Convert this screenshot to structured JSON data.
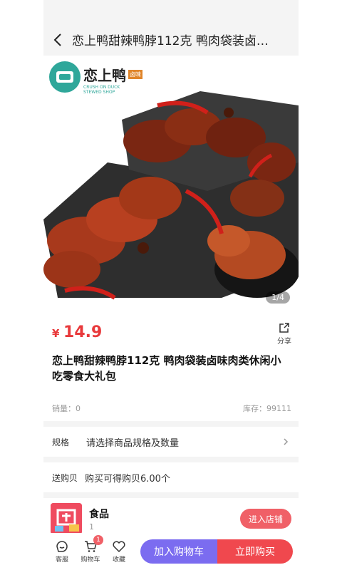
{
  "header": {
    "title": "恋上鸭甜辣鸭脖112克 鸭肉袋装卤…"
  },
  "gallery": {
    "brand_name": "恋上鸭",
    "brand_tag": "卤味",
    "brand_sub1": "CRUSH ON DUCK",
    "brand_sub2": "STEWED SHOP",
    "counter": "1/4"
  },
  "product": {
    "currency": "¥",
    "price": "14.9",
    "share_label": "分享",
    "title": "恋上鸭甜辣鸭脖112克 鸭肉袋装卤味肉类休闲小吃零食大礼包",
    "sales": "销量：0",
    "stock": "库存：99111"
  },
  "spec": {
    "label": "规格",
    "value": "请选择商品规格及数量"
  },
  "points": {
    "label": "送购贝",
    "value": "购买可得购贝6.00个"
  },
  "shop": {
    "name": "食品",
    "count": "1",
    "enter_label": "进入店铺"
  },
  "bottom": {
    "service_label": "客服",
    "cart_label": "购物车",
    "cart_badge": "1",
    "favorite_label": "收藏",
    "add_cart_label": "加入购物车",
    "buy_now_label": "立即购买"
  },
  "colors": {
    "price": "#e8393b",
    "add_cart": "#7b6cf0",
    "buy_now": "#f0484e",
    "enter_shop": "#f06067"
  }
}
